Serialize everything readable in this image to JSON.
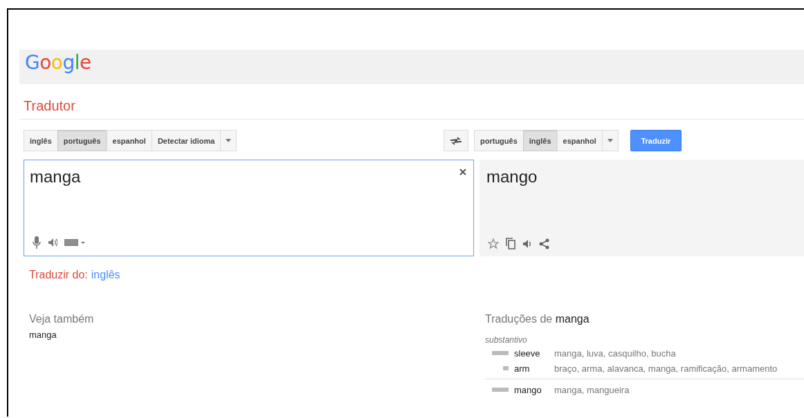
{
  "logo": "Google",
  "title": "Tradutor",
  "source_languages": [
    {
      "label": "inglês",
      "selected": false
    },
    {
      "label": "português",
      "selected": true
    },
    {
      "label": "espanhol",
      "selected": false
    },
    {
      "label": "Detectar idioma",
      "selected": false
    }
  ],
  "target_languages": [
    {
      "label": "português",
      "selected": false
    },
    {
      "label": "inglês",
      "selected": true
    },
    {
      "label": "espanhol",
      "selected": false
    }
  ],
  "translate_button": "Traduzir",
  "source_text": "manga",
  "output_text": "mango",
  "detected": {
    "prefix": "Traduzir do:",
    "language": "inglês"
  },
  "see_also": {
    "heading": "Veja também",
    "items": [
      "manga"
    ]
  },
  "translations": {
    "heading_prefix": "Traduções de",
    "heading_word": "manga",
    "groups": [
      {
        "part_of_speech": "substantivo",
        "entries": [
          {
            "word": "sleeve",
            "common": true,
            "synonyms": "manga, luva, casquilho, bucha"
          },
          {
            "word": "arm",
            "common": false,
            "synonyms": "braço, arma, alavanca, manga, ramificação, armamento"
          }
        ]
      },
      {
        "entries": [
          {
            "word": "mango",
            "common": true,
            "synonyms": "manga, mangueira"
          }
        ]
      }
    ]
  }
}
